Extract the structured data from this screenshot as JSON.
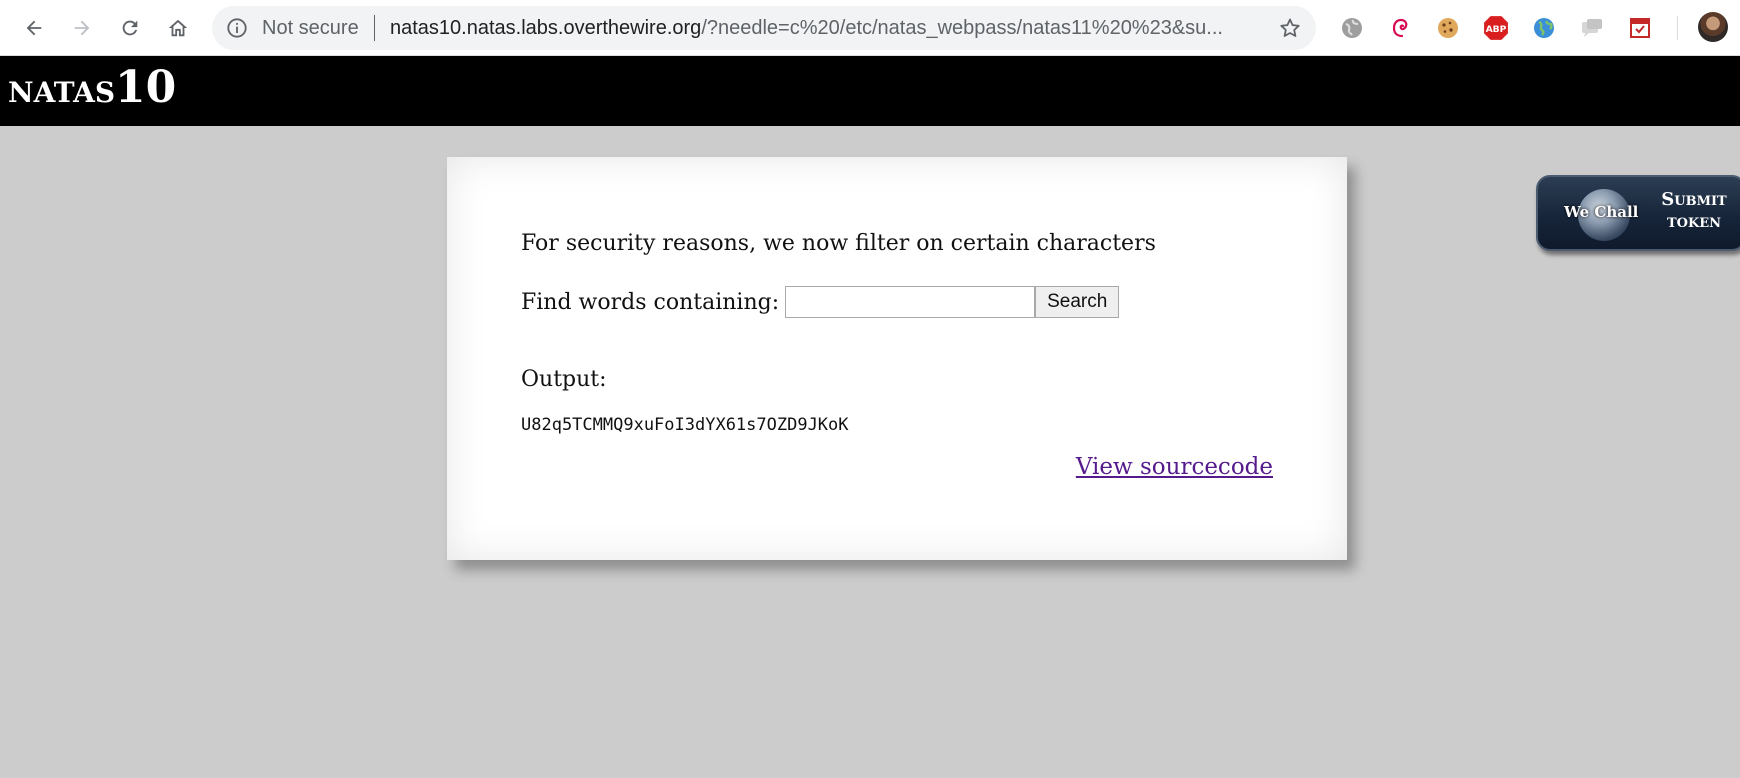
{
  "browser": {
    "security_label": "Not secure",
    "url_host": "natas10.natas.labs.overthewire.org",
    "url_path": "/?needle=c%20/etc/natas_webpass/natas11%20%23&su..."
  },
  "header": {
    "title_name": "natas",
    "title_number": "10"
  },
  "main": {
    "notice": "For security reasons, we now filter on certain characters",
    "search_label": "Find words containing:",
    "search_value": "",
    "search_button": "Search",
    "output_label": "Output:",
    "output_value": "U82q5TCMMQ9xuFoI3dYX61s7OZD9JKoK",
    "source_link": "View sourcecode"
  },
  "wechall": {
    "logo_text": "We Chall",
    "button_line1": "Submit",
    "button_line2": "token"
  },
  "colors": {
    "page_background": "#cccccc",
    "header_background": "#000000",
    "link_visited": "#551a8b"
  },
  "icons": [
    "back-icon",
    "forward-icon",
    "reload-icon",
    "home-icon",
    "info-icon",
    "star-icon"
  ]
}
